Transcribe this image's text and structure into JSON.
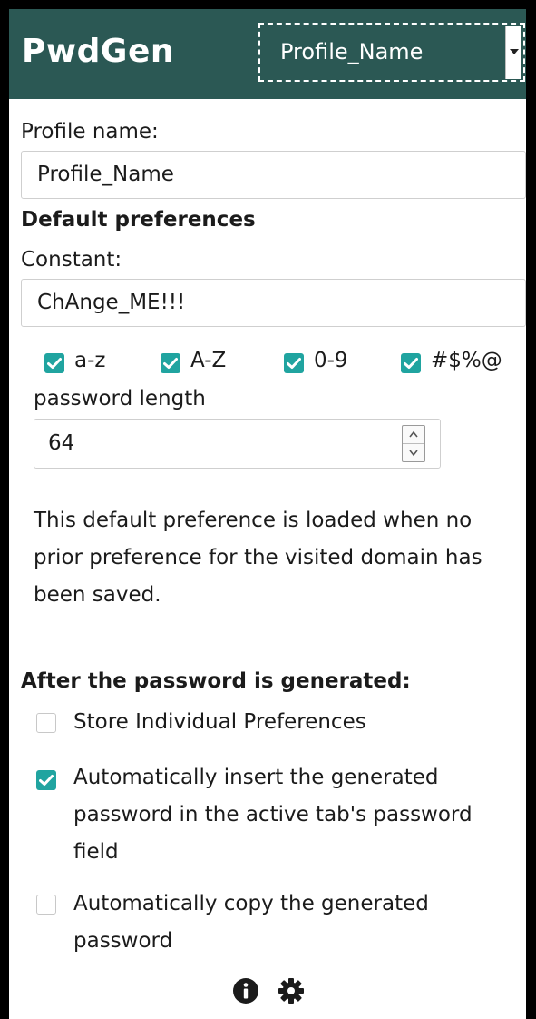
{
  "header": {
    "brand": "PwdGen",
    "profile_select": {
      "selected": "Profile_Name"
    }
  },
  "profile": {
    "label": "Profile name:",
    "value": "Profile_Name"
  },
  "defaults": {
    "heading": "Default preferences",
    "constant_label": "Constant:",
    "constant_value": "ChAnge_ME!!!",
    "charsets": [
      {
        "label": "a-z",
        "checked": true
      },
      {
        "label": "A-Z",
        "checked": true
      },
      {
        "label": "0-9",
        "checked": true
      },
      {
        "label": "#$%@",
        "checked": true
      }
    ],
    "length_label": "password length",
    "length_value": "64",
    "info": "This default preference is loaded when no prior preference for the visited domain has been saved."
  },
  "after": {
    "heading": "After the password is generated:",
    "options": [
      {
        "label": "Store Individual Preferences",
        "checked": false
      },
      {
        "label": "Automatically insert the generated password in the active tab's password field",
        "checked": true
      },
      {
        "label": "Automatically copy the generated password",
        "checked": false
      }
    ]
  },
  "footer": {
    "icons": [
      "info-icon",
      "gear-icon"
    ]
  },
  "colors": {
    "header_bg": "#2b5854",
    "accent": "#20a4a0"
  }
}
